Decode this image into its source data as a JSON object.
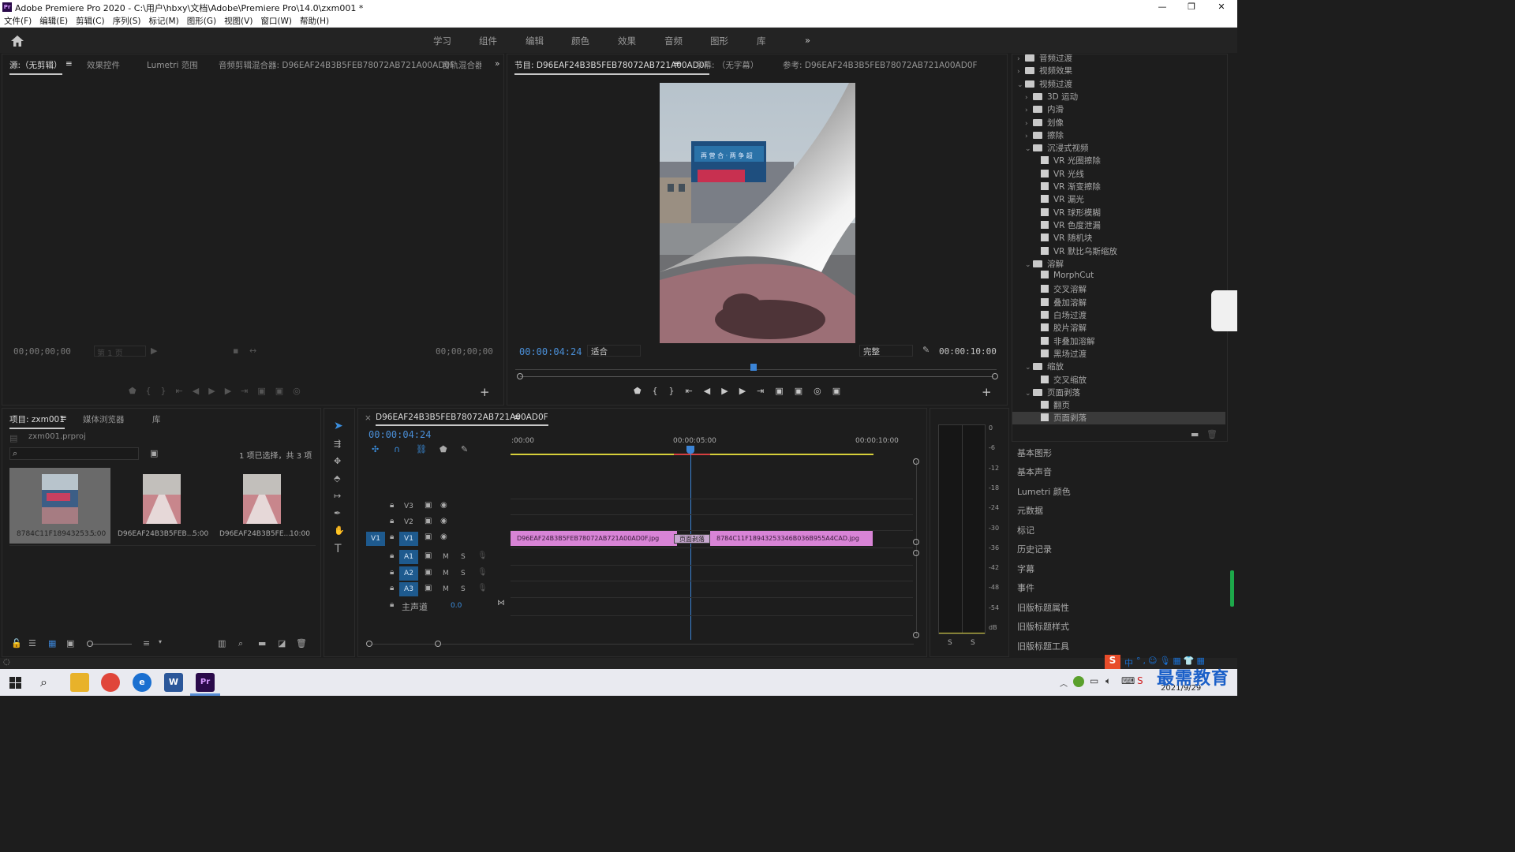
{
  "window": {
    "title": "Adobe Premiere Pro 2020 - C:\\用户\\hbxy\\文档\\Adobe\\Premiere Pro\\14.0\\zxm001 *",
    "logo": "Pr",
    "minimize": "—",
    "restore": "❐",
    "close": "✕"
  },
  "menu": [
    "文件(F)",
    "编辑(E)",
    "剪辑(C)",
    "序列(S)",
    "标记(M)",
    "图形(G)",
    "视图(V)",
    "窗口(W)",
    "帮助(H)"
  ],
  "workspaces": [
    "学习",
    "组件",
    "编辑",
    "颜色",
    "效果",
    "音频",
    "图形",
    "库"
  ],
  "source_panel": {
    "tabs": [
      "源:（无剪辑）",
      "效果控件",
      "Lumetri 范围",
      "音频剪辑混合器: D96EAF24B3B5FEB78072AB721A00AD0F",
      "音轨混合器"
    ],
    "timecode_left": "00;00;00;00",
    "page": "第 1 页",
    "timecode_right": "00;00;00;00"
  },
  "program_panel": {
    "tabs": [
      "节目: D96EAF24B3B5FEB78072AB721A00AD0F",
      "字幕: （无字幕）",
      "参考: D96EAF24B3B5FEB78072AB721A00AD0F"
    ],
    "timecode": "00:00:04:24",
    "fit": "适合",
    "quality": "完整",
    "duration": "00:00:10:00",
    "billboard_text": "再 营 合 · 两 争 超"
  },
  "project_panel": {
    "tabs": [
      "项目: zxm001",
      "媒体浏览器",
      "库"
    ],
    "file": "zxm001.prproj",
    "selection_info": "1 项已选择，共 3 项",
    "items": [
      {
        "name": "8784C11F18943253...",
        "duration": "5:00"
      },
      {
        "name": "D96EAF24B3B5FEB...",
        "duration": "5:00"
      },
      {
        "name": "D96EAF24B3B5FE...",
        "duration": "10:00"
      }
    ]
  },
  "timeline": {
    "sequence_name": "D96EAF24B3B5FEB78072AB721A00AD0F",
    "timecode": "00:00:04:24",
    "ruler": [
      ":00:00",
      "00:00:05:00",
      "00:00:10:00"
    ],
    "video_tracks": [
      "V3",
      "V2",
      "V1"
    ],
    "audio_tracks": [
      "A1",
      "A2",
      "A3"
    ],
    "source_patch": "V1",
    "master_label": "主声道",
    "master_value": "0.0",
    "clip1": "D96EAF24B3B5FEB78072AB721A00AD0F.jpg",
    "transition": "页面剥落",
    "clip2": "8784C11F18943253346B036B955A4CAD.jpg",
    "mute": "M",
    "solo": "S"
  },
  "audio_meter": {
    "scale": [
      "0",
      "-6",
      "-12",
      "-18",
      "-24",
      "-30",
      "-36",
      "-42",
      "-48",
      "-54",
      "dB"
    ],
    "channels": [
      "S",
      "S"
    ]
  },
  "effects_tree": [
    {
      "level": 0,
      "kind": "folder",
      "open": false,
      "label": "音频过渡"
    },
    {
      "level": 0,
      "kind": "folder",
      "open": false,
      "label": "视频效果"
    },
    {
      "level": 0,
      "kind": "folder",
      "open": true,
      "label": "视频过渡"
    },
    {
      "level": 1,
      "kind": "folder",
      "open": false,
      "label": "3D 运动"
    },
    {
      "level": 1,
      "kind": "folder",
      "open": false,
      "label": "内滑"
    },
    {
      "level": 1,
      "kind": "folder",
      "open": false,
      "label": "划像"
    },
    {
      "level": 1,
      "kind": "folder",
      "open": false,
      "label": "擦除"
    },
    {
      "level": 1,
      "kind": "folder",
      "open": true,
      "label": "沉浸式视频"
    },
    {
      "level": 2,
      "kind": "fx",
      "label": "VR 光圈擦除"
    },
    {
      "level": 2,
      "kind": "fx",
      "label": "VR 光线"
    },
    {
      "level": 2,
      "kind": "fx",
      "label": "VR 渐变擦除"
    },
    {
      "level": 2,
      "kind": "fx",
      "label": "VR 漏光"
    },
    {
      "level": 2,
      "kind": "fx",
      "label": "VR 球形模糊"
    },
    {
      "level": 2,
      "kind": "fx",
      "label": "VR 色度泄漏"
    },
    {
      "level": 2,
      "kind": "fx",
      "label": "VR 随机块"
    },
    {
      "level": 2,
      "kind": "fx",
      "label": "VR 默比乌斯缩放"
    },
    {
      "level": 1,
      "kind": "folder",
      "open": true,
      "label": "溶解"
    },
    {
      "level": 2,
      "kind": "fx",
      "label": "MorphCut"
    },
    {
      "level": 2,
      "kind": "fx",
      "label": "交叉溶解"
    },
    {
      "level": 2,
      "kind": "fx",
      "label": "叠加溶解"
    },
    {
      "level": 2,
      "kind": "fx",
      "label": "白场过渡"
    },
    {
      "level": 2,
      "kind": "fx",
      "label": "胶片溶解"
    },
    {
      "level": 2,
      "kind": "fx",
      "label": "非叠加溶解"
    },
    {
      "level": 2,
      "kind": "fx",
      "label": "黑场过渡"
    },
    {
      "level": 1,
      "kind": "folder",
      "open": true,
      "label": "缩放"
    },
    {
      "level": 2,
      "kind": "fx",
      "label": "交叉缩放"
    },
    {
      "level": 1,
      "kind": "folder",
      "open": true,
      "label": "页面剥落"
    },
    {
      "level": 2,
      "kind": "fx",
      "label": "翻页"
    },
    {
      "level": 2,
      "kind": "fx",
      "label": "页面剥落",
      "selected": true
    }
  ],
  "side_panels": [
    "基本图形",
    "基本声音",
    "Lumetri 颜色",
    "元数据",
    "标记",
    "历史记录",
    "字幕",
    "事件",
    "旧版标题属性",
    "旧版标题样式",
    "旧版标题工具"
  ],
  "taskbar": {
    "date": "2021/9/29",
    "ime": "中",
    "watermark": "最需教育"
  }
}
